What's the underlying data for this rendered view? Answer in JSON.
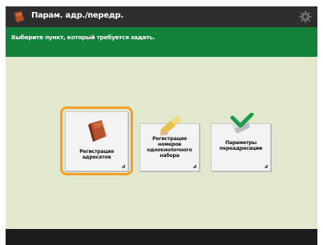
{
  "titlebar": {
    "icon": "address-book-icon",
    "title": "Парам. адр./передр.",
    "settings_icon": "gear-icon"
  },
  "banner": {
    "instruction": "Выберите пункт, который требуется задать."
  },
  "tiles": [
    {
      "label": "Регистрация адресатов",
      "icon": "address-book-icon",
      "selected": true
    },
    {
      "label": "Регистрация номеров однокнопочного набора",
      "icon": "one-touch-pen-icon",
      "selected": false
    },
    {
      "label": "Параметры переадресации",
      "icon": "forwarding-arrow-icon",
      "selected": false
    }
  ],
  "colors": {
    "titlebar": "#2e2e2e",
    "banner": "#12823a",
    "background": "#e2e8cd",
    "selection": "#f2a02a"
  }
}
